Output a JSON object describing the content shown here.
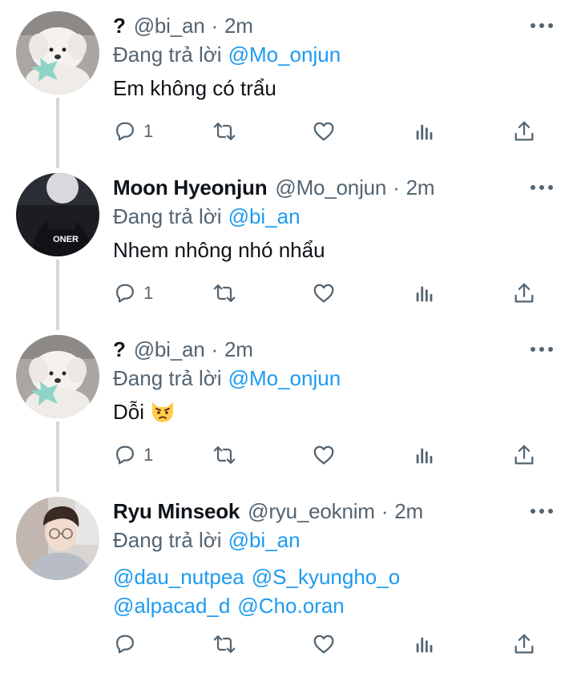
{
  "replying_prefix": "Đang trả lời",
  "colors": {
    "link": "#1d9bf0",
    "secondary": "#536471",
    "text": "#0f1419",
    "thread_line": "#cfd9de"
  },
  "tweets": [
    {
      "name": "?",
      "handle": "@bi_an",
      "time": "2m",
      "replying_to": "@Mo_onjun",
      "text": "Em không có trẩu",
      "reply_count": "1",
      "avatar": "white-puppy-avatar"
    },
    {
      "name": "Moon Hyeonjun",
      "handle": "@Mo_onjun",
      "time": "2m",
      "replying_to": "@bi_an",
      "text": "Nhem nhông nhó nhẩu",
      "reply_count": "1",
      "avatar": "oner-jersey-avatar",
      "avatar_text": "ONER"
    },
    {
      "name": "?",
      "handle": "@bi_an",
      "time": "2m",
      "replying_to": "@Mo_onjun",
      "text": "Dỗi",
      "emoji": "pouting-cat-emoji",
      "reply_count": "1",
      "avatar": "white-puppy-avatar"
    },
    {
      "name": "Ryu Minseok",
      "handle": "@ryu_eoknim",
      "time": "2m",
      "replying_to": "@bi_an",
      "mentions_line1": [
        "@dau_nutpea",
        "@S_kyungho_o"
      ],
      "mentions_line2": [
        "@alpacad_d",
        "@Cho.oran"
      ],
      "reply_count": "",
      "avatar": "person-glasses-avatar"
    }
  ]
}
